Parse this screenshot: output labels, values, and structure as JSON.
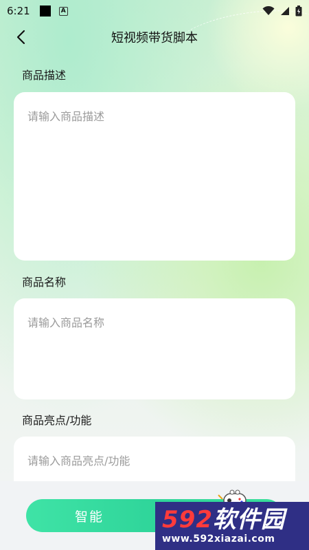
{
  "status_bar": {
    "time": "6:21",
    "icons": [
      "notification-square-icon",
      "a-badge-icon",
      "wifi-icon",
      "signal-icon",
      "battery-icon"
    ]
  },
  "header": {
    "title": "短视频带货脚本",
    "back_icon": "chevron-left-icon"
  },
  "form": {
    "description": {
      "label": "商品描述",
      "placeholder": "请输入商品描述",
      "value": ""
    },
    "name": {
      "label": "商品名称",
      "placeholder": "请输入商品名称",
      "value": ""
    },
    "highlights": {
      "label": "商品亮点/功能",
      "placeholder": "请输入商品亮点/功能",
      "value": ""
    }
  },
  "action": {
    "generate_label": "智能"
  },
  "watermark": {
    "brand_number": "592",
    "brand_text": "软件园",
    "url": "www.592xiazai.com"
  },
  "colors": {
    "accent_green": "#2fd59a",
    "watermark_bg": "#2f2f85",
    "watermark_red": "#ff3b3b"
  }
}
